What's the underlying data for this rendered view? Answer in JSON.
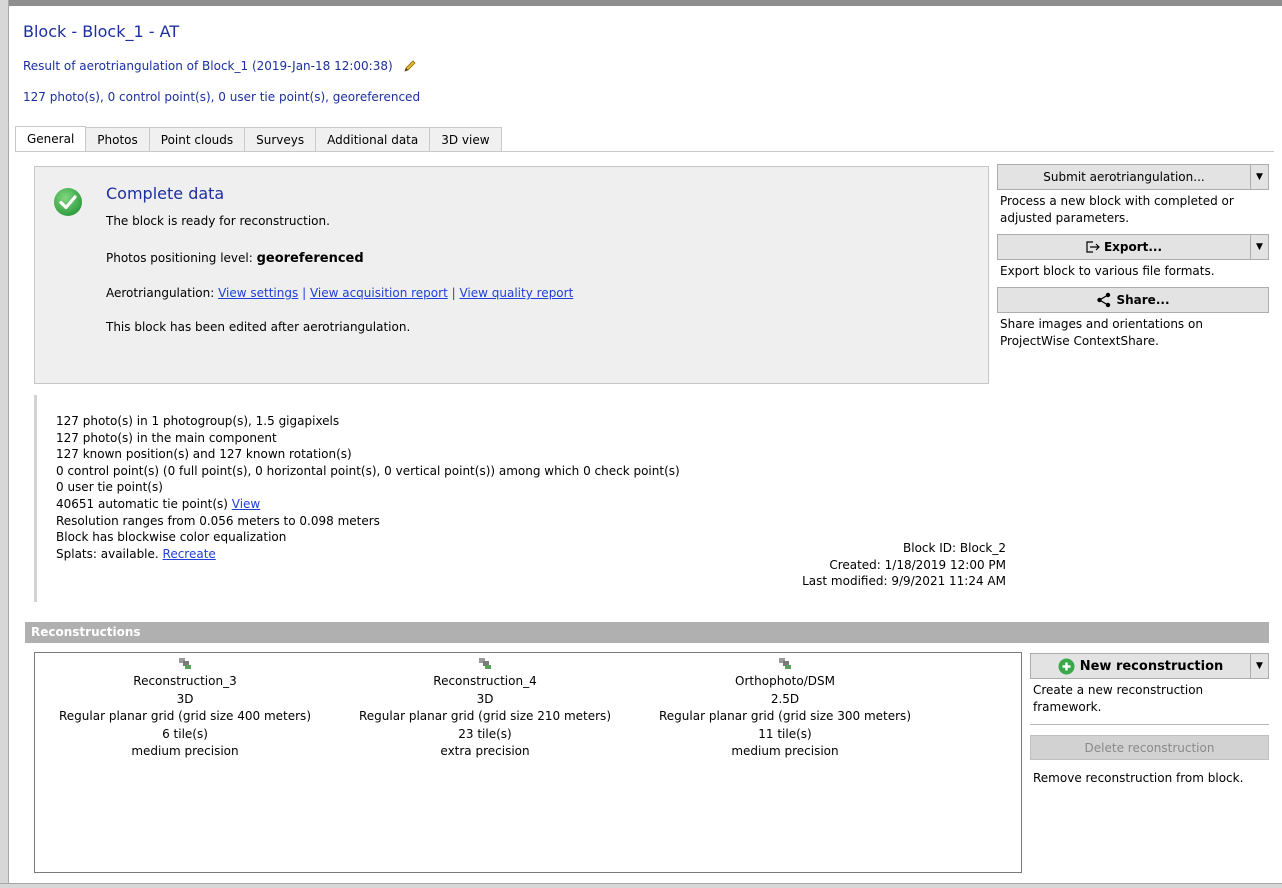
{
  "header": {
    "title": "Block - Block_1 - AT",
    "description": "Result of aerotriangulation of Block_1 (2019-Jan-18 12:00:38)",
    "summary": "127 photo(s), 0 control point(s), 0 user tie point(s), georeferenced"
  },
  "tabs": [
    {
      "label": "General"
    },
    {
      "label": "Photos"
    },
    {
      "label": "Point clouds"
    },
    {
      "label": "Surveys"
    },
    {
      "label": "Additional data"
    },
    {
      "label": "3D view"
    }
  ],
  "status": {
    "title": "Complete data",
    "ready_text": "The block is ready for reconstruction.",
    "positioning_label": "Photos positioning level: ",
    "positioning_value": "georeferenced",
    "at_label": "Aerotriangulation: ",
    "link_settings": "View settings",
    "link_acquisition": "View acquisition report",
    "link_quality": "View quality report",
    "separator": "|",
    "edited_text": "This block has been edited after aerotriangulation."
  },
  "actions": {
    "submit_label": "Submit aerotriangulation...",
    "submit_desc": "Process a new block with completed or adjusted parameters.",
    "export_label": "Export...",
    "export_desc": "Export block to various file formats.",
    "share_label": "Share...",
    "share_desc": "Share images and orientations on ProjectWise ContextShare."
  },
  "stats": {
    "line1": "127 photo(s) in 1 photogroup(s), 1.5 gigapixels",
    "line2": "127 photo(s) in the main component",
    "line3": "127 known position(s) and 127 known rotation(s)",
    "line4": "0 control point(s) (0 full point(s), 0 horizontal point(s), 0 vertical point(s)) among which 0 check point(s)",
    "line5": "0 user tie point(s)",
    "line6": "40651 automatic tie point(s) ",
    "line6_link": "View",
    "line7": "Resolution ranges from 0.056 meters to 0.098 meters",
    "line8": "Block has blockwise color equalization",
    "line9": "Splats: available. ",
    "line9_link": "Recreate",
    "block_id": "Block ID: Block_2",
    "created": "Created: 1/18/2019 12:00 PM",
    "modified": "Last modified: 9/9/2021 11:24 AM"
  },
  "reconstructions": {
    "header": "Reconstructions",
    "items": [
      {
        "name": "Reconstruction_3",
        "type": "3D",
        "grid": "Regular planar grid (grid size 400 meters)",
        "tiles": "6 tile(s)",
        "precision": "medium precision"
      },
      {
        "name": "Reconstruction_4",
        "type": "3D",
        "grid": "Regular planar grid (grid size 210 meters)",
        "tiles": "23 tile(s)",
        "precision": "extra precision"
      },
      {
        "name": "Orthophoto/DSM",
        "type": "2.5D",
        "grid": "Regular planar grid (grid size 300 meters)",
        "tiles": "11 tile(s)",
        "precision": "medium precision"
      }
    ],
    "new_label": "New reconstruction",
    "new_desc": "Create a new reconstruction framework.",
    "delete_label": "Delete reconstruction",
    "delete_desc": "Remove reconstruction from block."
  },
  "colors": {
    "title_blue": "#1b2f9e",
    "link_blue": "#1f3fd6",
    "check_green": "#3aa84a"
  }
}
